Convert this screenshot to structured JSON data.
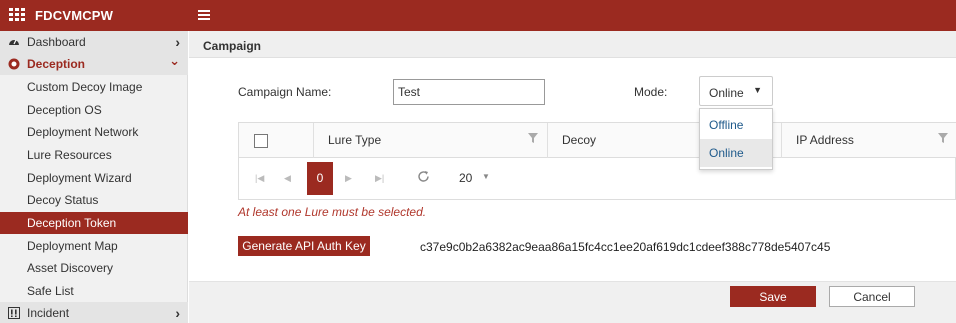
{
  "app": {
    "title": "FDCVMCPW"
  },
  "colors": {
    "brand": "#9b2a20",
    "link": "#1f5a8b",
    "error": "#b0372c"
  },
  "sidebar": {
    "items": [
      {
        "label": "Dashboard",
        "icon": "dashboard-icon",
        "chevron": "›"
      },
      {
        "label": "Deception",
        "icon": "deception-icon",
        "chevron": "⌄"
      },
      {
        "label": "Custom Decoy Image"
      },
      {
        "label": "Deception OS"
      },
      {
        "label": "Deployment Network"
      },
      {
        "label": "Lure Resources"
      },
      {
        "label": "Deployment Wizard"
      },
      {
        "label": "Decoy Status"
      },
      {
        "label": "Deception Token"
      },
      {
        "label": "Deployment Map"
      },
      {
        "label": "Asset Discovery"
      },
      {
        "label": "Safe List"
      },
      {
        "label": "Incident",
        "icon": "incident-icon",
        "chevron": "›"
      }
    ],
    "active": "Deception Token"
  },
  "main": {
    "section_title": "Campaign",
    "form": {
      "campaign_label": "Campaign Name:",
      "campaign_value": "Test",
      "mode_label": "Mode:",
      "mode_value": "Online",
      "mode_options": [
        "Offline",
        "Online"
      ]
    },
    "grid": {
      "columns": [
        "Lure Type",
        "Decoy",
        "IP Address"
      ],
      "pager": {
        "current_page": "0",
        "page_size": "20"
      }
    },
    "error_message": "At least one Lure must be selected.",
    "api_button": "Generate API Auth Key",
    "api_token": "c37e9c0b2a6382ac9eaa86a15fc4cc1ee20af619dc1cdeef388c778de5407c45",
    "save_label": "Save",
    "cancel_label": "Cancel"
  }
}
